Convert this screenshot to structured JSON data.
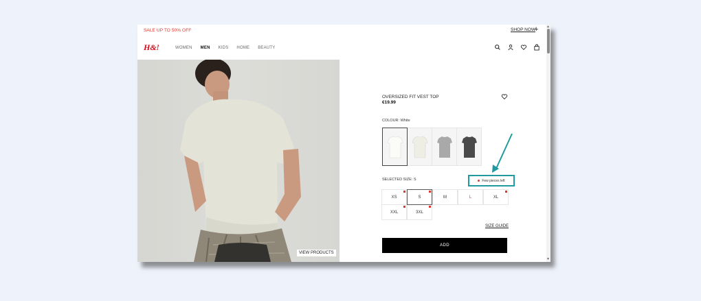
{
  "promo": {
    "text": "SALE UP TO 50% OFF",
    "cta": "SHOP NOW"
  },
  "brand": {
    "logo_text": "H&M",
    "color": "#e50010"
  },
  "nav": {
    "items": [
      "WOMEN",
      "MEN",
      "KIDS",
      "HOME",
      "BEAUTY"
    ],
    "active": "MEN"
  },
  "header_icons": [
    "search-icon",
    "account-icon",
    "favorites-icon",
    "shopping-bag-icon"
  ],
  "product": {
    "title": "OVERSIZED FIT VEST TOP",
    "price": "€19.99",
    "colour_label": "COLOUR: White",
    "colours": [
      "White",
      "Cream",
      "Light grey",
      "Dark grey"
    ],
    "selected_size_label": "SELECTED SIZE: S",
    "stock_note": "Few pieces left",
    "sizes": [
      {
        "label": "XS",
        "low_stock": true
      },
      {
        "label": "S",
        "low_stock": true,
        "selected": true
      },
      {
        "label": "M",
        "low_stock": false
      },
      {
        "label": "L",
        "low_stock": false,
        "unavailable": true
      },
      {
        "label": "XL",
        "low_stock": true
      },
      {
        "label": "XXL",
        "low_stock": true
      },
      {
        "label": "3XL",
        "low_stock": true
      }
    ],
    "size_guide": "SIZE GUIDE",
    "add_label": "ADD",
    "view_products": "VIEW PRODUCTS"
  },
  "colors": {
    "accent_annotation": "#1f9aa0",
    "sale_red": "#e0362c"
  }
}
